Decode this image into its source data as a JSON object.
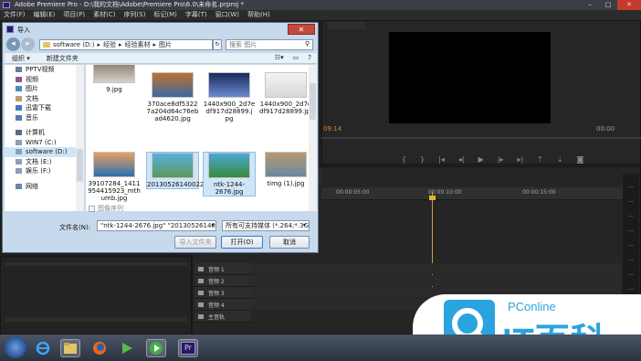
{
  "premiere": {
    "title": "Adobe Premiere Pro - D:\\我的文档\\Adobe\\Premiere Pro\\6.0\\未命名.prproj *",
    "menu": [
      "文件(F)",
      "编辑(E)",
      "项目(P)",
      "素材(C)",
      "序列(S)",
      "标记(M)",
      "字幕(T)",
      "窗口(W)",
      "帮助(H)"
    ],
    "timecode_left": "09:14",
    "timecode_right": "00:00",
    "ruler_ticks": [
      "00:00:05:00",
      "00:00:10:00",
      "00:00:15:00"
    ],
    "audio_tracks": [
      "音频 1",
      "音频 2",
      "音频 3",
      "音频 4",
      "主音轨"
    ]
  },
  "dialog": {
    "title": "导入",
    "close": "✕",
    "address": [
      "software (D:)",
      "经验",
      "经验素材",
      "图片"
    ],
    "search_placeholder": "搜索 图片",
    "toolbar": {
      "organize": "组织 ▾",
      "new_folder": "新建文件夹"
    },
    "sidebar": [
      {
        "label": "PPTV视频",
        "icon": "video-folder-icon",
        "color": "#6a7c9a"
      },
      {
        "label": "视频",
        "icon": "video-library-icon",
        "color": "#8c5a8c"
      },
      {
        "label": "图片",
        "icon": "picture-library-icon",
        "color": "#4a8ac4"
      },
      {
        "label": "文档",
        "icon": "document-library-icon",
        "color": "#b7a36a"
      },
      {
        "label": "迅雷下载",
        "icon": "download-folder-icon",
        "color": "#3c7cc8"
      },
      {
        "label": "音乐",
        "icon": "music-library-icon",
        "color": "#5a78b8"
      },
      {
        "label": "计算机",
        "icon": "computer-icon",
        "color": "#5a6a80"
      },
      {
        "label": "WIN7 (C:)",
        "icon": "drive-icon",
        "color": "#8aa0b8"
      },
      {
        "label": "software (D:)",
        "icon": "drive-icon",
        "color": "#8aa0b8"
      },
      {
        "label": "文档 (E:)",
        "icon": "drive-icon",
        "color": "#8aa0b8"
      },
      {
        "label": "娱乐 (F:)",
        "icon": "drive-icon",
        "color": "#8aa0b8"
      },
      {
        "label": "网络",
        "icon": "network-icon",
        "color": "#6a86a8"
      }
    ],
    "files": [
      {
        "name": "9.jpg",
        "colors": [
          "#7a6a5a",
          "#d8d0c8"
        ]
      },
      {
        "name": "370ace8df5322 7a204d64c76eb ad4620.jpg",
        "colors": [
          "#c07030",
          "#3a6aa0"
        ]
      },
      {
        "name": "1440x900_2d7e df917d28899.j pg",
        "colors": [
          "#1a2a5a",
          "#6a8ad0"
        ]
      },
      {
        "name": "1440x900_2d7e df917d28899.jpg",
        "colors": [
          "#f4f4f4",
          "#d8d8d8"
        ]
      },
      {
        "name": "39107284_1411 954415923_mth umb.jpg",
        "colors": [
          "#e8a060",
          "#2a70b0"
        ]
      },
      {
        "name": "20130526140022_5fM.le.jpg",
        "colors": [
          "#5ab0e0",
          "#5a9a5a"
        ]
      },
      {
        "name": "ntk-1244-2676.jpg",
        "colors": [
          "#4aa8d8",
          "#3a8a3a"
        ]
      },
      {
        "name": "timg (1).jpg",
        "colors": [
          "#b89870",
          "#6a8aa0"
        ]
      }
    ],
    "image_sequence": "图像序列",
    "filename_label": "文件名(N):",
    "filename_value": "\"ntk-1244-2676.jpg\" \"20130526140022_5",
    "filetype_value": "所有可支持媒体 (*.264;*.3G2;*",
    "btn_import_folder": "导入文件夹",
    "btn_open": "打开(O)",
    "btn_cancel": "取消"
  },
  "watermark": {
    "brand_small": "PConline",
    "brand_big": "IT百科"
  },
  "taskbar": {
    "apps": [
      "ie-icon",
      "explorer-icon",
      "firefox-icon",
      "media-player-icon",
      "pptv-icon",
      "premiere-icon"
    ],
    "premiere_label": "Pr"
  }
}
